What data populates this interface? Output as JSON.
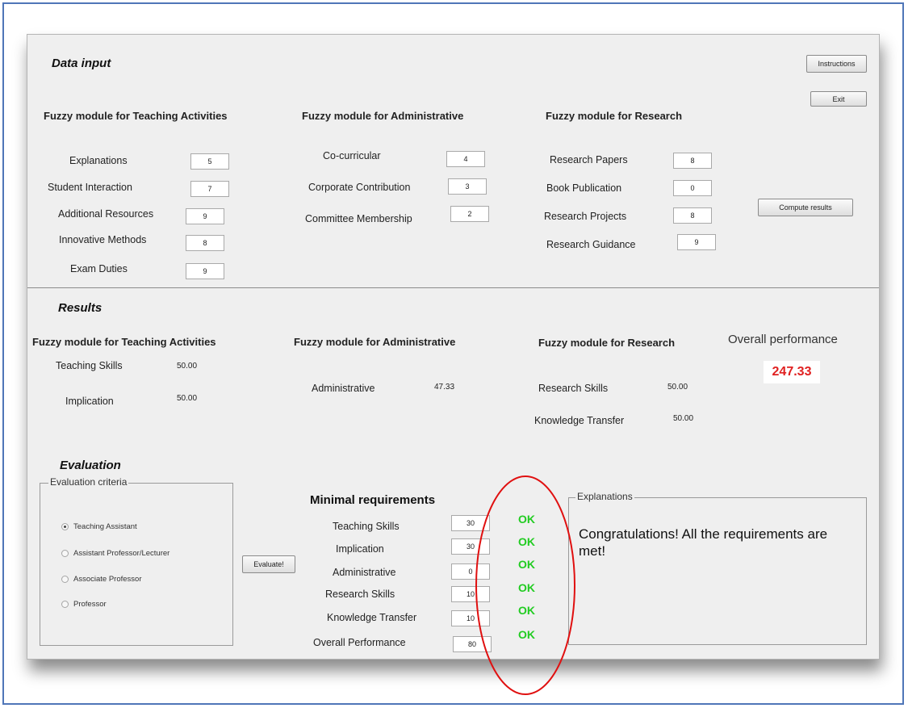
{
  "data_input": {
    "title": "Data input",
    "instructions_label": "Instructions",
    "exit_label": "Exit",
    "compute_label": "Compute results",
    "teaching": {
      "title": "Fuzzy module for Teaching Activities",
      "fields": [
        {
          "label": "Explanations",
          "value": "5"
        },
        {
          "label": "Student Interaction",
          "value": "7"
        },
        {
          "label": "Additional Resources",
          "value": "9"
        },
        {
          "label": "Innovative Methods",
          "value": "8"
        },
        {
          "label": "Exam Duties",
          "value": "9"
        }
      ]
    },
    "administrative": {
      "title": "Fuzzy module for Administrative",
      "fields": [
        {
          "label": "Co-curricular",
          "value": "4"
        },
        {
          "label": "Corporate Contribution",
          "value": "3"
        },
        {
          "label": "Committee Membership",
          "value": "2"
        }
      ]
    },
    "research": {
      "title": "Fuzzy module for Research",
      "fields": [
        {
          "label": "Research Papers",
          "value": "8"
        },
        {
          "label": "Book Publication",
          "value": "0"
        },
        {
          "label": "Research Projects",
          "value": "8"
        },
        {
          "label": "Research Guidance",
          "value": "9"
        }
      ]
    }
  },
  "results": {
    "title": "Results",
    "teaching": {
      "title": "Fuzzy module for Teaching Activities",
      "items": [
        {
          "label": "Teaching Skills",
          "value": "50.00"
        },
        {
          "label": "Implication",
          "value": "50.00"
        }
      ]
    },
    "administrative": {
      "title": "Fuzzy module for Administrative",
      "items": [
        {
          "label": "Administrative",
          "value": "47.33"
        }
      ]
    },
    "research": {
      "title": "Fuzzy module for Research",
      "items": [
        {
          "label": "Research Skills",
          "value": "50.00"
        },
        {
          "label": "Knowledge Transfer",
          "value": "50.00"
        }
      ]
    },
    "overall": {
      "label": "Overall performance",
      "value": "247.33",
      "value_color": "#e02020"
    }
  },
  "evaluation": {
    "title": "Evaluation",
    "criteria_legend": "Evaluation criteria",
    "options": [
      {
        "label": "Teaching Assistant",
        "selected": true
      },
      {
        "label": "Assistant Professor/Lecturer",
        "selected": false
      },
      {
        "label": "Associate Professor",
        "selected": false
      },
      {
        "label": "Professor",
        "selected": false
      }
    ],
    "evaluate_label": "Evaluate!",
    "minimal_title": "Minimal requirements",
    "requirements": [
      {
        "label": "Teaching Skills",
        "value": "30",
        "status": "OK"
      },
      {
        "label": "Implication",
        "value": "30",
        "status": "OK"
      },
      {
        "label": "Administrative",
        "value": "0",
        "status": "OK"
      },
      {
        "label": "Research Skills",
        "value": "10",
        "status": "OK"
      },
      {
        "label": "Knowledge Transfer",
        "value": "10",
        "status": "OK"
      },
      {
        "label": "Overall Performance",
        "value": "80",
        "status": "OK"
      }
    ],
    "status_color": "#22cc22",
    "explanations_legend": "Explanations",
    "explanation_text": "Congratulations! All the requirements are met!",
    "annotation_color": "#e01010"
  }
}
